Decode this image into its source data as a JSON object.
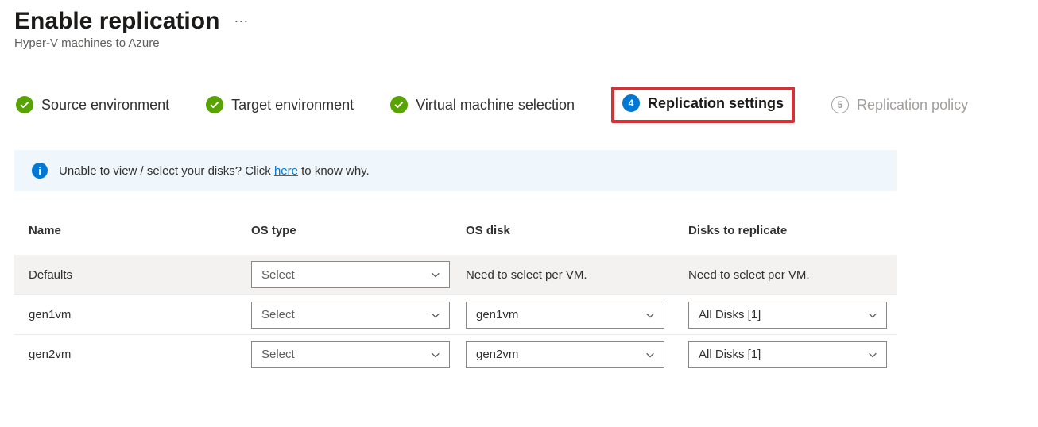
{
  "header": {
    "title": "Enable replication",
    "subtitle": "Hyper-V machines to Azure"
  },
  "steps": {
    "s1": "Source environment",
    "s2": "Target environment",
    "s3": "Virtual machine selection",
    "s4_num": "4",
    "s4": "Replication settings",
    "s5_num": "5",
    "s5": "Replication policy"
  },
  "info": {
    "text_a": "Unable to view / select your disks? Click ",
    "link": "here",
    "text_b": " to know why."
  },
  "table": {
    "headers": {
      "name": "Name",
      "os_type": "OS type",
      "os_disk": "OS disk",
      "disks": "Disks to replicate"
    },
    "defaults": {
      "name": "Defaults",
      "os_type_placeholder": "Select",
      "os_disk_text": "Need to select per VM.",
      "disks_text": "Need to select per VM."
    },
    "rows": [
      {
        "name": "gen1vm",
        "os_type": "Select",
        "os_disk": "gen1vm",
        "disks": "All Disks [1]"
      },
      {
        "name": "gen2vm",
        "os_type": "Select",
        "os_disk": "gen2vm",
        "disks": "All Disks [1]"
      }
    ]
  }
}
